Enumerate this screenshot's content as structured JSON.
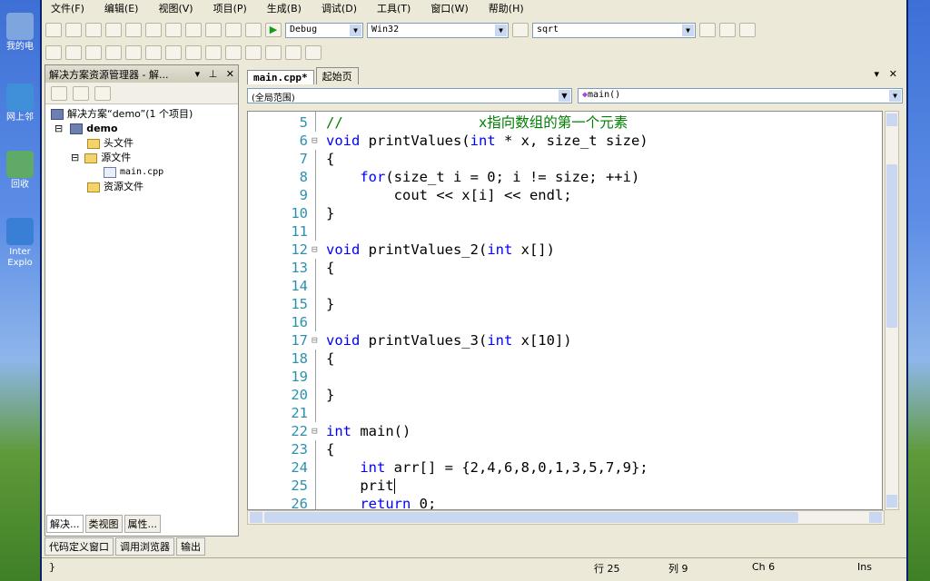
{
  "desktop": {
    "icons": [
      {
        "label": "我的电",
        "name": "my-computer-icon"
      },
      {
        "label": "网上邻",
        "name": "network-icon"
      },
      {
        "label": "回收",
        "name": "recycle-bin-icon"
      },
      {
        "label": "Inter Explo",
        "name": "internet-explorer-icon"
      }
    ]
  },
  "menu": [
    "文件(F)",
    "编辑(E)",
    "视图(V)",
    "项目(P)",
    "生成(B)",
    "调试(D)",
    "工具(T)",
    "窗口(W)",
    "帮助(H)"
  ],
  "toolbar": {
    "config": "Debug",
    "platform": "Win32",
    "find": "sqrt"
  },
  "solution": {
    "title": "解决方案资源管理器 - 解...",
    "items": [
      "解决方案“demo”(1 个项目)",
      "demo",
      "头文件",
      "源文件",
      "main.cpp",
      "资源文件"
    ],
    "tabs": [
      "解决...",
      "类视图",
      "属性..."
    ]
  },
  "editor": {
    "tabs": [
      "main.cpp*",
      "起始页"
    ],
    "scope_left": "(全局范围)",
    "scope_right": "main()",
    "lines": [
      {
        "n": "5",
        "parts": [
          {
            "t": "//                x指向数组的第一个元素",
            "c": "cm"
          }
        ]
      },
      {
        "n": "6",
        "parts": [
          {
            "t": "void",
            "c": "kw"
          },
          {
            "t": " printValues("
          },
          {
            "t": "int",
            "c": "kw"
          },
          {
            "t": " * x, size_t size)"
          }
        ]
      },
      {
        "n": "7",
        "parts": [
          {
            "t": "{"
          }
        ]
      },
      {
        "n": "8",
        "parts": [
          {
            "t": "    "
          },
          {
            "t": "for",
            "c": "kw"
          },
          {
            "t": "(size_t i = 0; i != size; ++i)"
          }
        ]
      },
      {
        "n": "9",
        "parts": [
          {
            "t": "        cout << x[i] << endl;"
          }
        ]
      },
      {
        "n": "10",
        "parts": [
          {
            "t": "}"
          }
        ]
      },
      {
        "n": "11",
        "parts": []
      },
      {
        "n": "12",
        "parts": [
          {
            "t": "void",
            "c": "kw"
          },
          {
            "t": " printValues_2("
          },
          {
            "t": "int",
            "c": "kw"
          },
          {
            "t": " x[])"
          }
        ]
      },
      {
        "n": "13",
        "parts": [
          {
            "t": "{"
          }
        ]
      },
      {
        "n": "14",
        "parts": []
      },
      {
        "n": "15",
        "parts": [
          {
            "t": "}"
          }
        ]
      },
      {
        "n": "16",
        "parts": []
      },
      {
        "n": "17",
        "parts": [
          {
            "t": "void",
            "c": "kw"
          },
          {
            "t": " printValues_3("
          },
          {
            "t": "int",
            "c": "kw"
          },
          {
            "t": " x[10])"
          }
        ]
      },
      {
        "n": "18",
        "parts": [
          {
            "t": "{"
          }
        ]
      },
      {
        "n": "19",
        "parts": []
      },
      {
        "n": "20",
        "parts": [
          {
            "t": "}"
          }
        ]
      },
      {
        "n": "21",
        "parts": []
      },
      {
        "n": "22",
        "parts": [
          {
            "t": "int",
            "c": "kw"
          },
          {
            "t": " main()"
          }
        ]
      },
      {
        "n": "23",
        "parts": [
          {
            "t": "{"
          }
        ]
      },
      {
        "n": "24",
        "parts": [
          {
            "t": "    "
          },
          {
            "t": "int",
            "c": "kw"
          },
          {
            "t": " arr[] = {2,4,6,8,0,1,3,5,7,9};"
          }
        ]
      },
      {
        "n": "25",
        "parts": [
          {
            "t": "    prit"
          }
        ]
      },
      {
        "n": "26",
        "parts": [
          {
            "t": "    "
          },
          {
            "t": "return",
            "c": "kw"
          },
          {
            "t": " 0;"
          }
        ]
      }
    ]
  },
  "bottom_tabs": [
    "代码定义窗口",
    "调用浏览器",
    "输出"
  ],
  "status": {
    "left": "}",
    "row": "行 25",
    "col": "列 9",
    "ch": "Ch 6",
    "mode": "Ins"
  }
}
